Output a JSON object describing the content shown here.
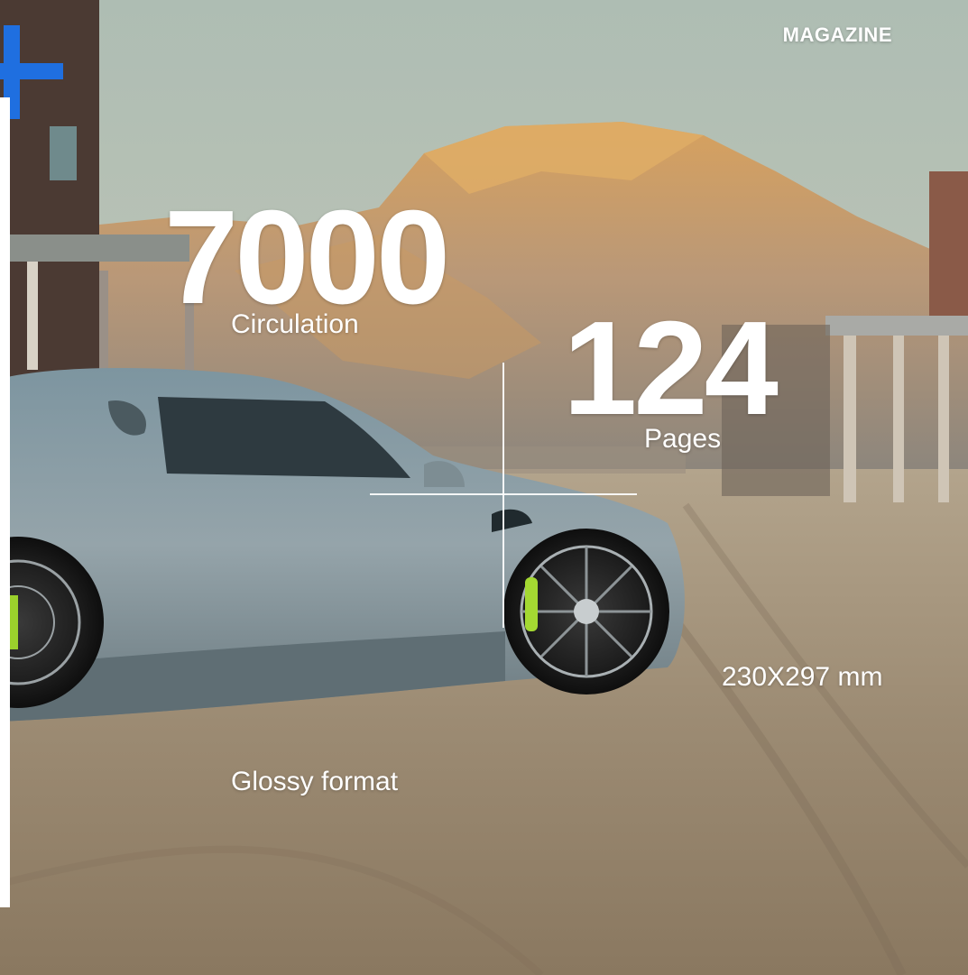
{
  "header": {
    "section_label": "MAGAZINE"
  },
  "stats": {
    "circulation": {
      "value": "7000",
      "label": "Circulation"
    },
    "pages": {
      "value": "124",
      "label": "Pages"
    },
    "dimensions": "230X297 mm",
    "format": "Glossy format"
  },
  "colors": {
    "brand_blue": "#1f6fe0",
    "text": "#ffffff"
  },
  "icons": {
    "brand_mark": "plus-icon"
  }
}
